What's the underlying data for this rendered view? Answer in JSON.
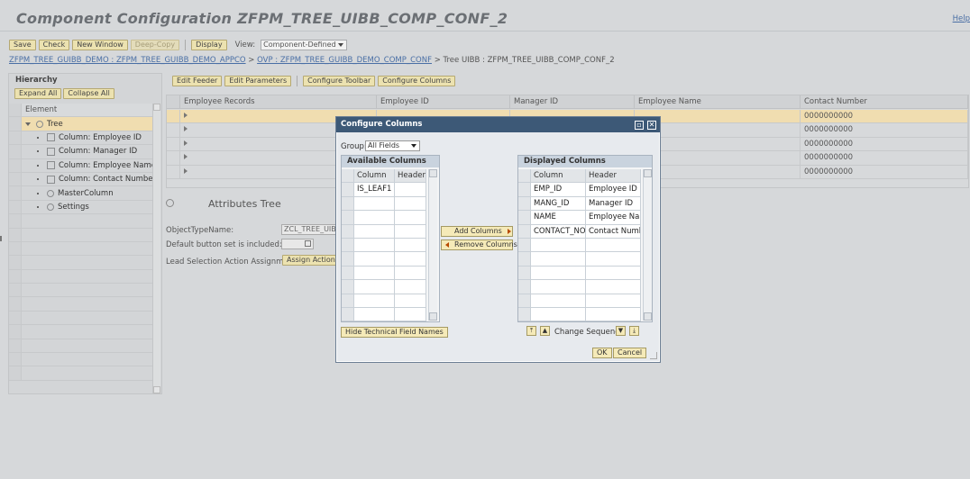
{
  "page": {
    "title": "Component Configuration ZFPM_TREE_UIBB_COMP_CONF_2",
    "help": "Help"
  },
  "toolbar": {
    "save": "Save",
    "check": "Check",
    "new_window": "New Window",
    "deep_copy": "Deep-Copy",
    "display": "Display",
    "view_label": "View:",
    "view_value": "Component-Defined"
  },
  "breadcrumb": {
    "item1": "ZFPM_TREE_GUIBB_DEMO : ZFPM_TREE_GUIBB_DEMO_APPCO",
    "sep1": ">",
    "item2": "OVP : ZFPM_TREE_GUIBB_DEMO_COMP_CONF",
    "sep2": ">",
    "item3": "Tree UIBB : ZFPM_TREE_UIBB_COMP_CONF_2"
  },
  "hierarchy": {
    "title": "Hierarchy",
    "expand_all": "Expand All",
    "collapse_all": "Collapse All",
    "column_header": "Element",
    "items": [
      {
        "label": "Tree"
      },
      {
        "label": "Column: Employee ID"
      },
      {
        "label": "Column: Manager ID"
      },
      {
        "label": "Column: Employee Name"
      },
      {
        "label": "Column: Contact Number"
      },
      {
        "label": "MasterColumn"
      },
      {
        "label": "Settings"
      }
    ]
  },
  "main_buttons": {
    "edit_feeder": "Edit Feeder",
    "edit_parameters": "Edit Parameters",
    "configure_toolbar": "Configure Toolbar",
    "configure_columns": "Configure Columns"
  },
  "preview_table": {
    "headers": [
      "Employee Records",
      "Employee ID",
      "Manager ID",
      "Employee Name",
      "Contact Number"
    ],
    "rows": [
      {
        "contact": "0000000000"
      },
      {
        "contact": "0000000000"
      },
      {
        "contact": "0000000000"
      },
      {
        "contact": "0000000000"
      },
      {
        "contact": "0000000000"
      }
    ]
  },
  "attributes": {
    "title": "Attributes Tree",
    "object_type_label": "ObjectTypeName:",
    "object_type_value": "ZCL_TREE_UIBB",
    "default_btn_label": "Default button set is included:",
    "lead_sel_label": "Lead Selection Action Assignment:",
    "assign_action": "Assign Action"
  },
  "dialog": {
    "title": "Configure Columns",
    "group_label": "Group:",
    "group_value": "All Fields",
    "available": {
      "title": "Available Columns",
      "headers": [
        "Column",
        "Header"
      ],
      "rows": [
        {
          "column": "IS_LEAF1",
          "header": ""
        }
      ]
    },
    "displayed": {
      "title": "Displayed Columns",
      "headers": [
        "Column",
        "Header"
      ],
      "rows": [
        {
          "column": "EMP_ID",
          "header": "Employee ID"
        },
        {
          "column": "MANG_ID",
          "header": "Manager ID"
        },
        {
          "column": "NAME",
          "header": "Employee Name"
        },
        {
          "column": "CONTACT_NO",
          "header": "Contact Number"
        }
      ]
    },
    "add_columns": "Add Columns",
    "remove_columns": "Remove Columns",
    "hide_tech": "Hide Technical Field Names",
    "change_sequence": "Change Sequence",
    "ok": "OK",
    "cancel": "Cancel"
  }
}
